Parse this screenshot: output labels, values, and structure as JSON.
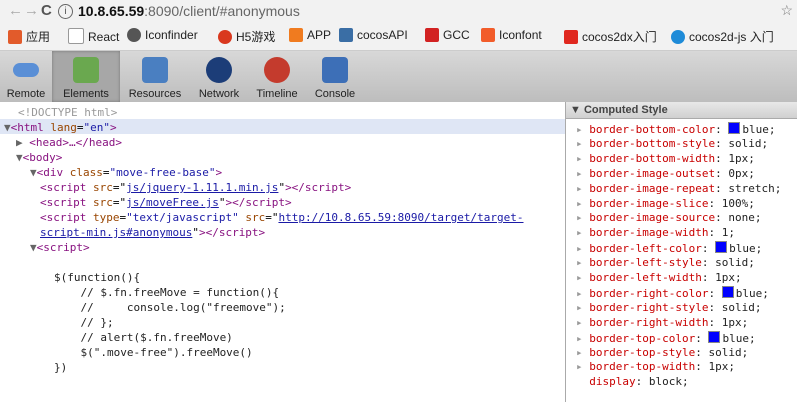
{
  "address_bar": {
    "back": "←",
    "forward": "→",
    "reload": "C",
    "info": "i",
    "host": "10.8.65.59",
    "path": ":8090/client/#anonymous",
    "star": "☆"
  },
  "bookmarks": [
    {
      "label": "应用",
      "color": "#e25b2b"
    },
    {
      "label": "React",
      "color": "#dddddd"
    },
    {
      "label": "Iconfinder",
      "color": "#555555"
    },
    {
      "label": "H5游戏",
      "color": "#d9381e"
    },
    {
      "label": "APP",
      "color": "#f07b1f"
    },
    {
      "label": "cocosAPI",
      "color": "#3a6ea5"
    },
    {
      "label": "GCC",
      "color": "#d22222"
    },
    {
      "label": "Iconfont",
      "color": "#f25c2a"
    },
    {
      "label": "cocos2dx入门",
      "color": "#e0281f"
    },
    {
      "label": "cocos2d-js 入门",
      "color": "#1e8bd8"
    }
  ],
  "toolbar": [
    {
      "label": "Remote",
      "color": "#5a8fd6"
    },
    {
      "label": "Elements",
      "color": "#6aa84f"
    },
    {
      "label": "Resources",
      "color": "#4a7fc1"
    },
    {
      "label": "Network",
      "color": "#1c3d78"
    },
    {
      "label": "Timeline",
      "color": "#c43b2d"
    },
    {
      "label": "Console",
      "color": "#3d6fb7"
    }
  ],
  "elements": {
    "doctype": "<!DOCTYPE html>",
    "html_open_tag": "html",
    "html_lang_attr": "lang",
    "html_lang_val": "\"en\"",
    "head_text": "<head>…</head>",
    "body_tag": "<body>",
    "div_open": "<div ",
    "div_attr": "class",
    "div_val": "\"move-free-base\"",
    "script1_src": "js/jquery-1.11.1.min.js",
    "script2_src": "js/moveFree.js",
    "script3_type": "\"text/javascript\"",
    "script3_src_1": "http://10.8.65.59:8090/target/target-",
    "script3_src_2": "script-min.js#anonymous",
    "script_open": "<script>",
    "code": [
      "$(function(){",
      "    // $.fn.freeMove = function(){",
      "    //     console.log(\"freemove\");",
      "    // };",
      "    // alert($.fn.freeMove)",
      "    $(\".move-free\").freeMove()",
      "})"
    ]
  },
  "computed": {
    "title": "Computed Style",
    "rows": [
      {
        "prop": "border-bottom-color",
        "val": "blue;",
        "swatch": true
      },
      {
        "prop": "border-bottom-style",
        "val": "solid;"
      },
      {
        "prop": "border-bottom-width",
        "val": "1px;"
      },
      {
        "prop": "border-image-outset",
        "val": "0px;"
      },
      {
        "prop": "border-image-repeat",
        "val": "stretch;"
      },
      {
        "prop": "border-image-slice",
        "val": "100%;"
      },
      {
        "prop": "border-image-source",
        "val": "none;"
      },
      {
        "prop": "border-image-width",
        "val": "1;"
      },
      {
        "prop": "border-left-color",
        "val": "blue;",
        "swatch": true
      },
      {
        "prop": "border-left-style",
        "val": "solid;"
      },
      {
        "prop": "border-left-width",
        "val": "1px;"
      },
      {
        "prop": "border-right-color",
        "val": "blue;",
        "swatch": true
      },
      {
        "prop": "border-right-style",
        "val": "solid;"
      },
      {
        "prop": "border-right-width",
        "val": "1px;"
      },
      {
        "prop": "border-top-color",
        "val": "blue;",
        "swatch": true
      },
      {
        "prop": "border-top-style",
        "val": "solid;"
      },
      {
        "prop": "border-top-width",
        "val": "1px;"
      },
      {
        "prop": "display",
        "val": "block;"
      }
    ]
  }
}
